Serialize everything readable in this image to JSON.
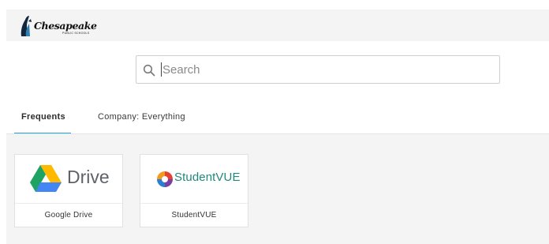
{
  "header": {
    "logo": {
      "script": "Chesapeake",
      "subtitle": "PUBLIC SCHOOLS"
    }
  },
  "search": {
    "placeholder": "Search",
    "value": ""
  },
  "tabs": [
    {
      "label": "Frequents",
      "active": true
    },
    {
      "label": "Company: Everything",
      "active": false
    }
  ],
  "apps": [
    {
      "name": "Google Drive",
      "logo_text": "Drive",
      "icon": "google-drive-icon"
    },
    {
      "name": "StudentVUE",
      "logo_text": "StudentVUE",
      "icon": "studentvue-icon"
    }
  ],
  "colors": {
    "accent": "#2aa3d8",
    "background": "#f4f4f5",
    "drive_green": "#1ea362",
    "drive_yellow": "#ffba00",
    "drive_blue": "#4285f4",
    "studentvue_teal": "#1f8a7a"
  }
}
